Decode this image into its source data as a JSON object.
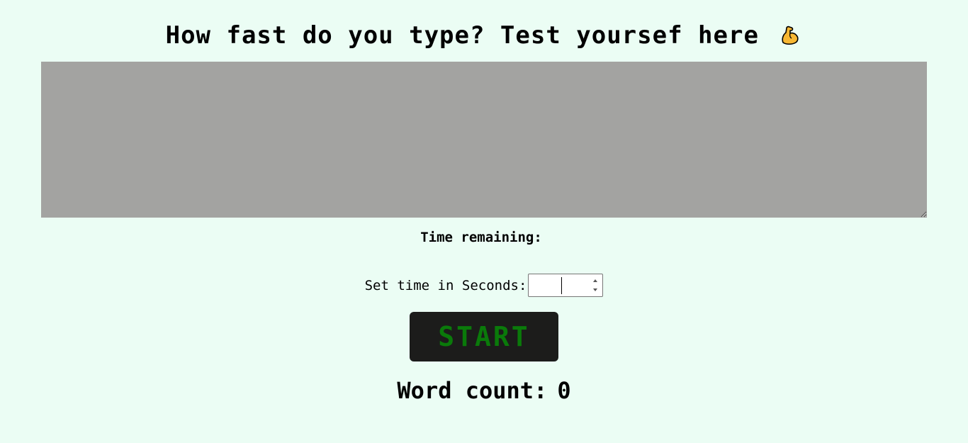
{
  "header": {
    "title": "How fast do you type? Test yoursef here",
    "emoji_icon": "flexed-biceps-icon"
  },
  "typing_area": {
    "value": "",
    "background": "#a3a3a1"
  },
  "timer": {
    "label": "Time remaining:",
    "value": ""
  },
  "settings": {
    "label": "Set time in Seconds:",
    "seconds_value": ""
  },
  "start_button": {
    "label": "START",
    "background": "#1c1c1b",
    "text_color": "#0a7a0a"
  },
  "stats": {
    "word_count_label": "Word count:",
    "word_count_value": "0"
  },
  "colors": {
    "page_background": "#ebfdf4"
  }
}
